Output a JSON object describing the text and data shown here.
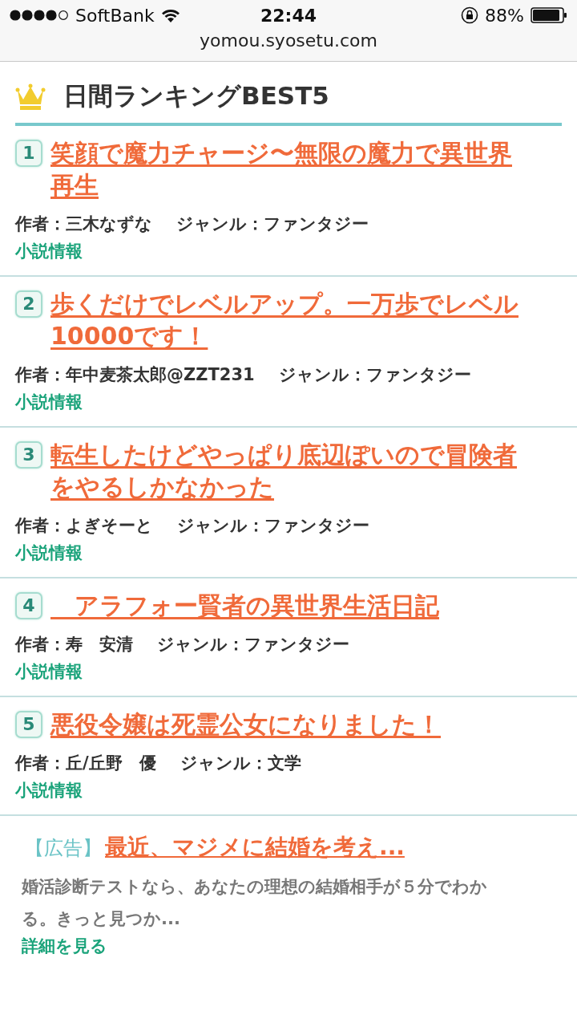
{
  "status_bar": {
    "carrier": "SoftBank",
    "time": "22:44",
    "battery": "88%"
  },
  "address_bar": {
    "url": "yomou.syosetu.com"
  },
  "heading": "日間ランキングBEST5",
  "rankings": [
    {
      "rank": "1",
      "title": "笑顔で魔力チャージ〜無限の魔力で異世界再生",
      "author": "作者：三木なずな",
      "genre": "ジャンル：ファンタジー",
      "info_link": "小説情報"
    },
    {
      "rank": "2",
      "title": "歩くだけでレベルアップ。一万歩でレベル10000です！",
      "author": "作者：年中麦茶太郎@ZZT231",
      "genre": "ジャンル：ファンタジー",
      "info_link": "小説情報"
    },
    {
      "rank": "3",
      "title": "転生したけどやっぱり底辺ぽいので冒険者をやるしかなかった",
      "author": "作者：よぎそーと",
      "genre": "ジャンル：ファンタジー",
      "info_link": "小説情報"
    },
    {
      "rank": "4",
      "title": "　アラフォー賢者の異世界生活日記",
      "author": "作者：寿　安清",
      "genre": "ジャンル：ファンタジー",
      "info_link": "小説情報"
    },
    {
      "rank": "5",
      "title": "悪役令嬢は死霊公女になりました！",
      "author": "作者：丘/丘野　優",
      "genre": "ジャンル：文学",
      "info_link": "小説情報"
    }
  ],
  "ad": {
    "tag": "【広告】",
    "title": "最近、マジメに結婚を考え...",
    "description": "婚活診断テストなら、あなたの理想の結婚相手が５分でわかる。きっと見つか...",
    "link": "詳細を見る"
  }
}
